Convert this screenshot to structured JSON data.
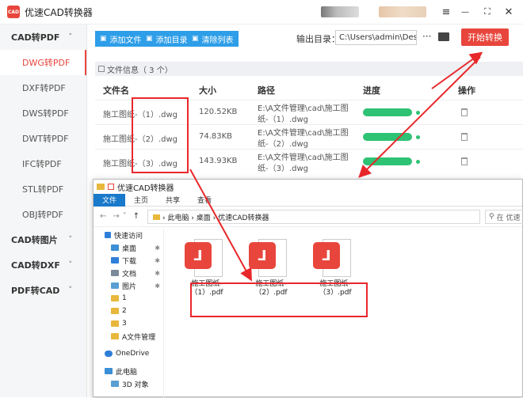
{
  "app": {
    "title": "优速CAD转换器",
    "logo_text": "CAD"
  },
  "window_controls": {
    "menu": "≡",
    "minimize": "—",
    "maximize": "⛶",
    "close": "✕"
  },
  "sidebar": {
    "categories": [
      {
        "label": "CAD转PDF",
        "chevron": "˄",
        "items": [
          "DWG转PDF",
          "DXF转PDF",
          "DWS转PDF",
          "DWT转PDF",
          "IFC转PDF",
          "STL转PDF",
          "OBJ转PDF"
        ],
        "active": "DWG转PDF"
      },
      {
        "label": "CAD转图片",
        "chevron": "˅"
      },
      {
        "label": "CAD转DXF",
        "chevron": "˅"
      },
      {
        "label": "PDF转CAD",
        "chevron": "˅"
      }
    ]
  },
  "toolbar": {
    "add_file": "添加文件",
    "add_dir": "添加目录",
    "clear_list": "清除列表",
    "output_label": "输出目录：",
    "output_path": "C:\\Users\\admin\\Deskto",
    "more": "···",
    "start": "开始转换"
  },
  "file_info": {
    "label": "文件信息（ 3 个）"
  },
  "table": {
    "headers": [
      "文件名",
      "大小",
      "路径",
      "进度",
      "操作"
    ],
    "rows": [
      {
        "name": "施工图纸-（1）.dwg",
        "size": "120.52KB",
        "path1": "E:\\A文件管理\\cad\\施工图",
        "path2": "纸-（1）.dwg",
        "progress": 1.0
      },
      {
        "name": "施工图纸-（2）.dwg",
        "size": "74.83KB",
        "path1": "E:\\A文件管理\\cad\\施工图",
        "path2": "纸-（2）.dwg",
        "progress": 1.0
      },
      {
        "name": "施工图纸-（3）.dwg",
        "size": "143.93KB",
        "path1": "E:\\A文件管理\\cad\\施工图",
        "path2": "纸-（3）.dwg",
        "progress": 1.0
      }
    ]
  },
  "explorer": {
    "title": "优速CAD转换器",
    "ribbon": [
      "文件",
      "主页",
      "共享",
      "查看"
    ],
    "breadcrumb": "› 此电脑 › 桌面 › 优速CAD转换器",
    "search_placeholder": "在 优速",
    "nav": [
      {
        "label": "快速访问",
        "pinned": false,
        "color": "#2f7ed8"
      },
      {
        "label": "桌面",
        "pinned": true,
        "color": "#3a8fd6"
      },
      {
        "label": "下载",
        "pinned": true,
        "color": "#2f7ed8"
      },
      {
        "label": "文档",
        "pinned": true,
        "color": "#7a8a99"
      },
      {
        "label": "图片",
        "pinned": true,
        "color": "#5a9fd4"
      },
      {
        "label": "1",
        "pinned": false,
        "color": "#e8b83c"
      },
      {
        "label": "2",
        "pinned": false,
        "color": "#e8b83c"
      },
      {
        "label": "3",
        "pinned": false,
        "color": "#e8b83c"
      },
      {
        "label": "A文件管理",
        "pinned": false,
        "color": "#e8b83c"
      },
      {
        "label": "",
        "pinned": false,
        "color": ""
      },
      {
        "label": "OneDrive",
        "pinned": false,
        "color": "#2f7ed8"
      },
      {
        "label": "",
        "pinned": false,
        "color": ""
      },
      {
        "label": "此电脑",
        "pinned": false,
        "color": "#3a8fd6"
      },
      {
        "label": "3D 对象",
        "pinned": false,
        "color": "#5a9fd4"
      }
    ],
    "files": [
      {
        "line1": "施工图纸-",
        "line2": "（1）.pdf"
      },
      {
        "line1": "施工图纸-",
        "line2": "（2）.pdf"
      },
      {
        "line1": "施工图纸-",
        "line2": "（3）.pdf"
      }
    ]
  },
  "colors": {
    "accent": "#e8463c",
    "blue": "#2e9ee8",
    "progress": "#2ec274",
    "annotation": "#e8272b"
  }
}
